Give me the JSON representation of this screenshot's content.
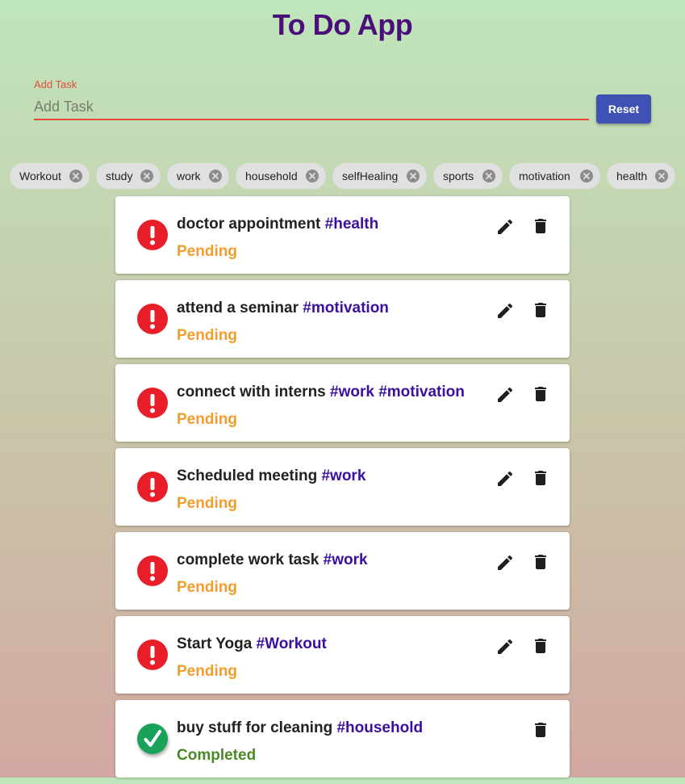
{
  "app": {
    "title": "To Do App"
  },
  "add_task": {
    "label": "Add Task",
    "placeholder": "Add Task",
    "value": "",
    "reset_label": "Reset"
  },
  "tags": [
    "Workout",
    "study",
    "work",
    "household",
    "selfHealing",
    "sports",
    "motivation",
    "health"
  ],
  "tasks": [
    {
      "text": "doctor appointment",
      "tags": "#health",
      "status": "Pending"
    },
    {
      "text": "attend a seminar",
      "tags": "#motivation",
      "status": "Pending"
    },
    {
      "text": "connect with interns",
      "tags": "#work #motivation",
      "status": "Pending"
    },
    {
      "text": "Scheduled meeting",
      "tags": "#work",
      "status": "Pending"
    },
    {
      "text": "complete work task",
      "tags": "#work",
      "status": "Pending"
    },
    {
      "text": "Start Yoga",
      "tags": "#Workout",
      "status": "Pending"
    },
    {
      "text": "buy stuff for cleaning",
      "tags": "#household",
      "status": "Completed"
    }
  ],
  "icons": {
    "pending": "exclamation-circle-icon",
    "completed": "check-circle-icon",
    "edit": "pencil-icon",
    "delete": "trash-icon",
    "chip_remove": "cancel-circle-icon"
  },
  "colors": {
    "title": "#4a0f7a",
    "accent_error": "#e44b3a",
    "button": "#3f51b5",
    "tag": "#3b0fa0",
    "pending": "#f59c2e",
    "completed": "#4a8a26",
    "pending_icon": "#e81f2a",
    "completed_icon": "#1aa25a"
  }
}
